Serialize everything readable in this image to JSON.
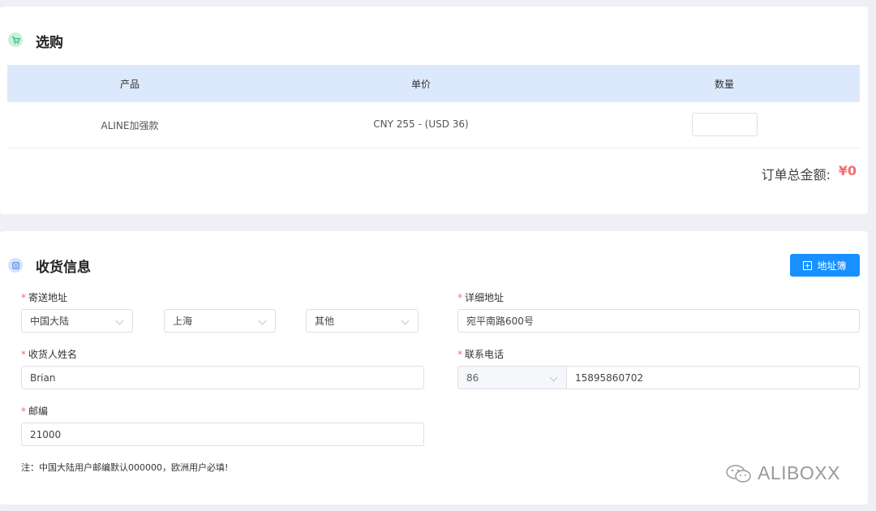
{
  "purchase": {
    "title": "选购",
    "columns": [
      "产品",
      "单价",
      "数量"
    ],
    "rows": [
      {
        "product": "ALINE加强款",
        "price": "CNY 255 - (USD 36)",
        "quantity": ""
      }
    ],
    "total_label": "订单总金额:",
    "total_value": "¥0"
  },
  "shipping": {
    "title": "收货信息",
    "address_book_button": "地址簿",
    "address_label": "寄送地址",
    "country": "中国大陆",
    "province": "上海",
    "district": "其他",
    "detail_label": "详细地址",
    "detail_value": "宛平南路600号",
    "name_label": "收货人姓名",
    "name_value": "Brian",
    "phone_label": "联系电话",
    "phone_code": "86",
    "phone_value": "15895860702",
    "zip_label": "邮编",
    "zip_value": "21000",
    "note": "注：中国大陆用户邮编默认000000，欧洲用户必填!"
  },
  "watermark": {
    "text": "ALIBOXX",
    "icon": "wechat-icon"
  },
  "colors": {
    "accent": "#1890ff",
    "required": "#f56c6c",
    "header_bg": "#dce8fb",
    "total": "#f56c6c"
  }
}
